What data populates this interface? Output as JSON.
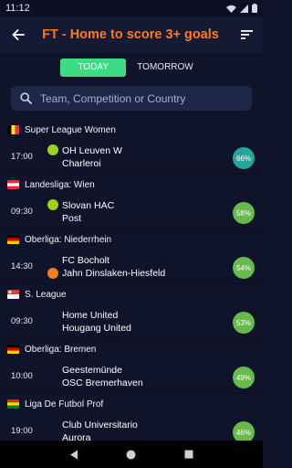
{
  "status": {
    "time": "11:12"
  },
  "header": {
    "title": "FT - Home to score 3+ goals"
  },
  "tabs": [
    {
      "label": "TODAY",
      "active": true
    },
    {
      "label": "TOMORROW",
      "active": false
    }
  ],
  "search": {
    "placeholder": "Team, Competition or Country"
  },
  "leagues": [
    {
      "name": "Super League Women",
      "flag": "belgium-flag",
      "time": "17:00",
      "home": "OH Leuven W",
      "away": "Charleroi",
      "pct": "66%",
      "pct_color": "#26a69a",
      "home_badge": "#9ad21f",
      "away_badge": ""
    },
    {
      "name": "Landesliga: Wien",
      "flag": "austria-flag",
      "time": "09:30",
      "home": "Slovan HAC",
      "away": "Post",
      "pct": "58%",
      "pct_color": "#66bb4a",
      "home_badge": "#9ad21f",
      "away_badge": ""
    },
    {
      "name": "Oberliga: Niederrhein",
      "flag": "germany-flag",
      "time": "14:30",
      "home": "FC Bocholt",
      "away": "Jahn Dinslaken-Hiesfeld",
      "pct": "54%",
      "pct_color": "#66bb4a",
      "home_badge": "",
      "away_badge": "#f57c1f"
    },
    {
      "name": "S. League",
      "flag": "singapore-flag",
      "time": "09:30",
      "home": "Home United",
      "away": "Hougang United",
      "pct": "53%",
      "pct_color": "#66bb4a",
      "home_badge": "",
      "away_badge": ""
    },
    {
      "name": "Oberliga: Bremen",
      "flag": "germany-flag",
      "time": "10:00",
      "home": "Geestemünde",
      "away": "OSC Bremerhaven",
      "pct": "49%",
      "pct_color": "#66bb4a",
      "home_badge": "",
      "away_badge": ""
    },
    {
      "name": "Liga De Futbol Prof",
      "flag": "bolivia-flag",
      "time": "19:00",
      "home": "Club Universitario",
      "away": "Aurora",
      "pct": "46%",
      "pct_color": "#66bb4a",
      "home_badge": "",
      "away_badge": ""
    }
  ]
}
